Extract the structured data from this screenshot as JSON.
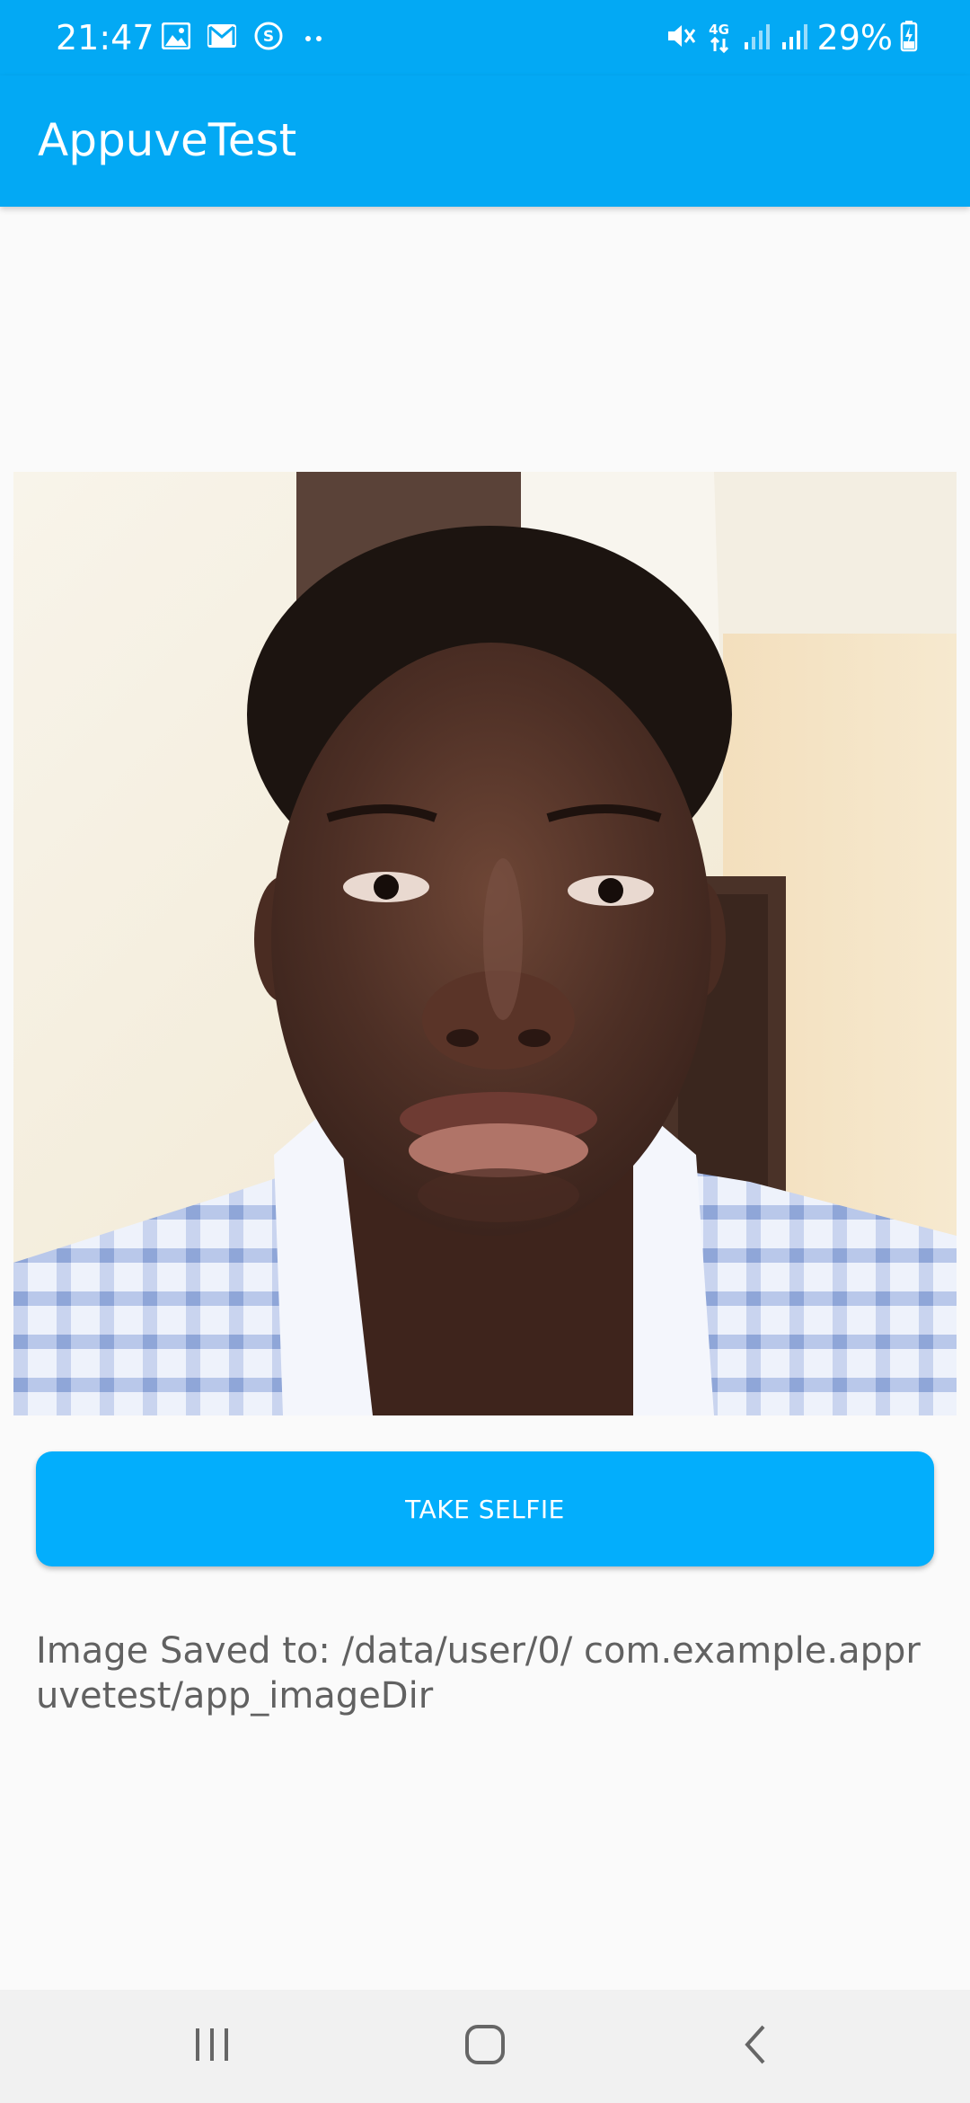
{
  "status_bar": {
    "time": "21:47",
    "battery_percent": "29%",
    "network_label": "4G",
    "left_icons": [
      "gallery-icon",
      "gmail-icon",
      "skype-icon",
      "more-dots-icon"
    ],
    "right_icons": [
      "mute-icon",
      "network-4g-icon",
      "signal-icon",
      "signal-icon",
      "battery-charging-icon"
    ]
  },
  "app_bar": {
    "title": "AppuveTest",
    "color": "#03a9f4"
  },
  "photo": {
    "description_icon": "selfie-photo"
  },
  "actions": {
    "take_selfie_label": "TAKE SELFIE",
    "button_color": "#03aefc"
  },
  "result": {
    "saved_path_text": "Image Saved to: /data/user/0/ com.example.appruvetest/app_imageDir"
  },
  "nav_bar": {
    "buttons": [
      "recents-icon",
      "home-icon",
      "back-icon"
    ]
  }
}
